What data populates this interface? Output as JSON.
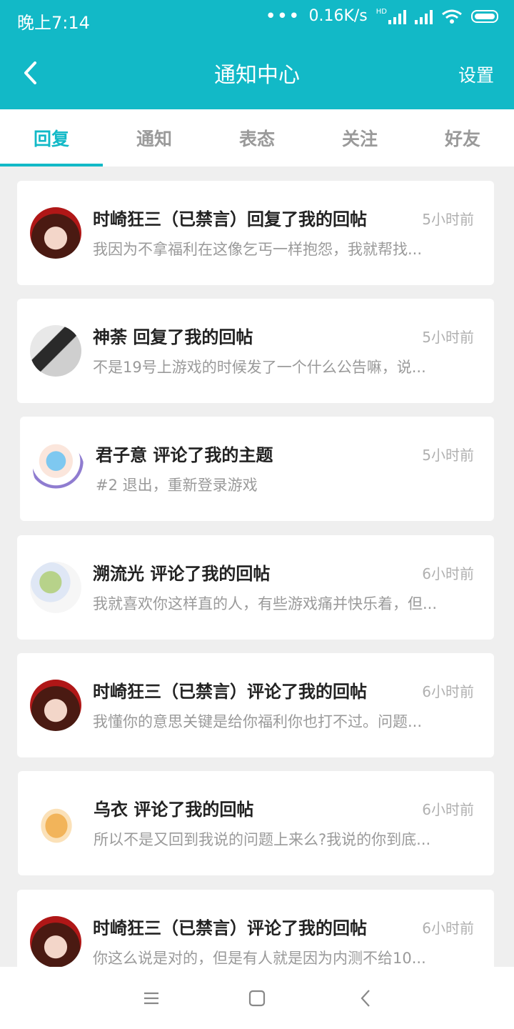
{
  "status_bar": {
    "time": "晚上7:14",
    "net_speed": "0.16K/s",
    "network": "HD"
  },
  "header": {
    "title": "通知中心",
    "settings_label": "设置"
  },
  "tabs": [
    {
      "label": "回复"
    },
    {
      "label": "通知"
    },
    {
      "label": "表态"
    },
    {
      "label": "关注"
    },
    {
      "label": "好友"
    }
  ],
  "active_tab": "回复",
  "notifications": [
    {
      "title": "时崎狂三（已禁言）回复了我的回帖",
      "time": "5小时前",
      "text": "我因为不拿福利在这像乞丐一样抱怨，我就帮找..."
    },
    {
      "title": "神荼 回复了我的回帖",
      "time": "5小时前",
      "text": "不是19号上游戏的时候发了一个什么公告嘛，说..."
    },
    {
      "title": "君子意 评论了我的主题",
      "time": "5小时前",
      "text": "#2 退出，重新登录游戏"
    },
    {
      "title": "溯流光 评论了我的回帖",
      "time": "6小时前",
      "text": "我就喜欢你这样直的人，有些游戏痛并快乐着，但..."
    },
    {
      "title": "时崎狂三（已禁言）评论了我的回帖",
      "time": "6小时前",
      "text": "我懂你的意思关键是给你福利你也打不过。问题..."
    },
    {
      "title": "乌衣 评论了我的回帖",
      "time": "6小时前",
      "text": "所以不是又回到我说的问题上来么?我说的你到底..."
    },
    {
      "title": "时崎狂三（已禁言）评论了我的回帖",
      "time": "6小时前",
      "text": "你这么说是对的，但是有人就是因为内测不给10..."
    }
  ],
  "colors": {
    "accent": "#12b9c7",
    "background": "#efefef"
  },
  "nav": {
    "menu": "menu-icon",
    "home": "home-icon",
    "back": "back-icon"
  }
}
